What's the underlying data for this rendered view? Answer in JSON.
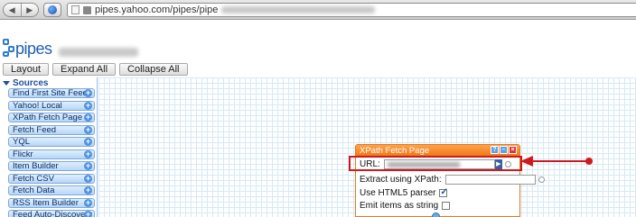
{
  "browser": {
    "url_visible": "pipes.yahoo.com/pipes/pipe"
  },
  "header": {
    "logo_text": "pipes"
  },
  "toolbar": {
    "layout_label": "Layout",
    "expand_label": "Expand All",
    "collapse_label": "Collapse All"
  },
  "sidebar": {
    "section_label": "Sources",
    "items": [
      {
        "label": "Find First Site Feed"
      },
      {
        "label": "Yahoo! Local"
      },
      {
        "label": "XPath Fetch Page"
      },
      {
        "label": "Fetch Feed"
      },
      {
        "label": "YQL"
      },
      {
        "label": "Flickr"
      },
      {
        "label": "Item Builder"
      },
      {
        "label": "Fetch CSV"
      },
      {
        "label": "Fetch Data"
      },
      {
        "label": "RSS Item Builder"
      },
      {
        "label": "Feed Auto-Discovery"
      }
    ]
  },
  "module": {
    "title": "XPath Fetch Page",
    "url_label": "URL:",
    "xpath_label": "Extract using XPath:",
    "html5_label": "Use HTML5 parser",
    "html5_checked": true,
    "emit_label": "Emit items as string",
    "emit_checked": false,
    "ctrl_help": "?",
    "ctrl_min": "–",
    "ctrl_close": "×"
  },
  "colors": {
    "module_orange": "#ee7a18",
    "highlight_red": "#d0191f",
    "sidebar_blue": "#b7d6f7"
  }
}
